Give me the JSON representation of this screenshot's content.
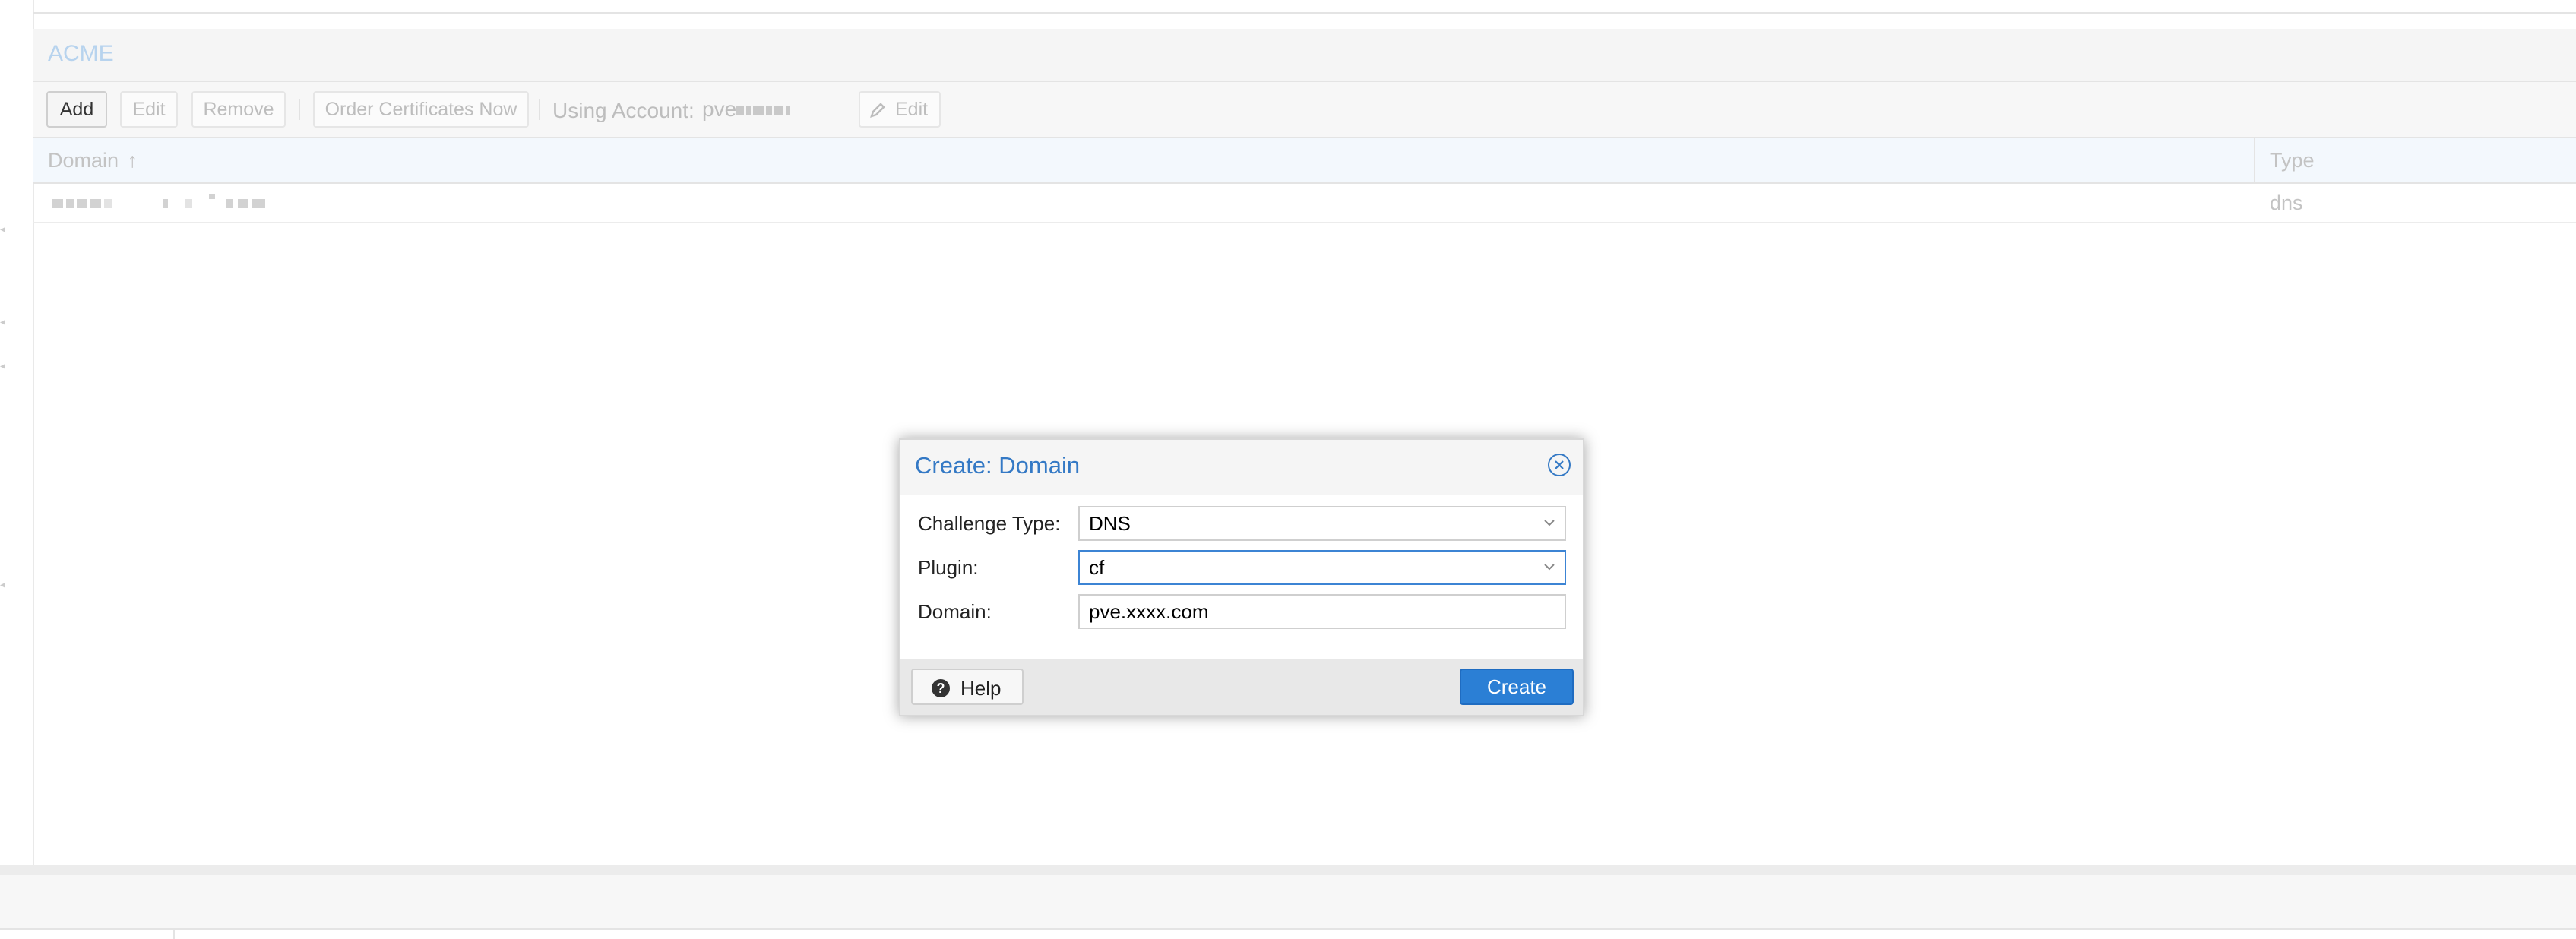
{
  "panel": {
    "title": "ACME"
  },
  "toolbar": {
    "add_label": "Add",
    "edit_label": "Edit",
    "remove_label": "Remove",
    "order_label": "Order Certificates Now",
    "account_label": "Using Account:",
    "account_value": "pve",
    "account_edit_label": "Edit"
  },
  "grid": {
    "columns": [
      "Domain",
      "Type"
    ],
    "sort_indicator": "↑",
    "rows": [
      {
        "domain": "",
        "type": "dns"
      }
    ]
  },
  "dialog": {
    "title": "Create: Domain",
    "fields": [
      {
        "label": "Challenge Type:",
        "value": "DNS"
      },
      {
        "label": "Plugin:",
        "value": "cf"
      },
      {
        "label": "Domain:",
        "value": "pve.xxxx.com"
      }
    ],
    "help_label": "Help",
    "create_label": "Create"
  },
  "colors": {
    "accent": "#3479c5",
    "primary_button": "#2b7fd5",
    "focus_border": "#3c84d4"
  },
  "icons": [
    "pencil-icon",
    "sort-up-icon",
    "close-icon",
    "chevron-down-icon",
    "help-icon"
  ]
}
